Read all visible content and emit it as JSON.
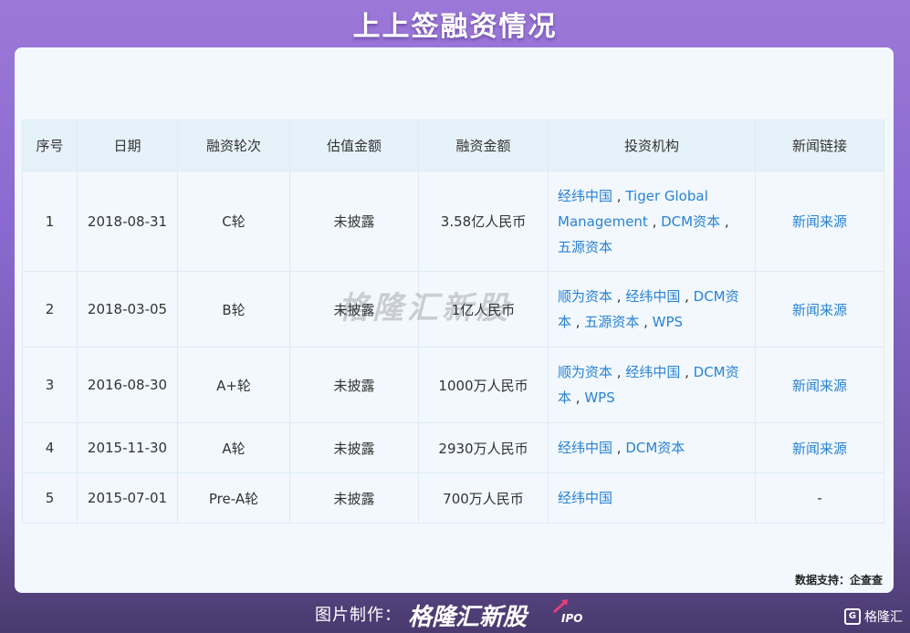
{
  "title": "上上签融资情况",
  "watermark": "格隆汇新股",
  "table": {
    "headers": [
      "序号",
      "日期",
      "融资轮次",
      "估值金额",
      "融资金额",
      "投资机构",
      "新闻链接"
    ],
    "rows": [
      {
        "no": "1",
        "date": "2018-08-31",
        "round": "C轮",
        "valuation": "未披露",
        "amount": "3.58亿人民币",
        "investors": [
          "经纬中国",
          "Tiger Global Management",
          "DCM资本",
          "五源资本"
        ],
        "news": "新闻来源"
      },
      {
        "no": "2",
        "date": "2018-03-05",
        "round": "B轮",
        "valuation": "未披露",
        "amount": "1亿人民币",
        "investors": [
          "顺为资本",
          "经纬中国",
          "DCM资本",
          "五源资本",
          "WPS"
        ],
        "news": "新闻来源"
      },
      {
        "no": "3",
        "date": "2016-08-30",
        "round": "A+轮",
        "valuation": "未披露",
        "amount": "1000万人民币",
        "investors": [
          "顺为资本",
          "经纬中国",
          "DCM资本",
          "WPS"
        ],
        "news": "新闻来源"
      },
      {
        "no": "4",
        "date": "2015-11-30",
        "round": "A轮",
        "valuation": "未披露",
        "amount": "2930万人民币",
        "investors": [
          "经纬中国",
          "DCM资本"
        ],
        "news": "新闻来源"
      },
      {
        "no": "5",
        "date": "2015-07-01",
        "round": "Pre-A轮",
        "valuation": "未披露",
        "amount": "700万人民币",
        "investors": [
          "经纬中国"
        ],
        "news": "-"
      }
    ]
  },
  "source": "数据支持：企查查",
  "footer": {
    "label": "图片制作：",
    "brand": "格隆汇新股",
    "brand_suffix": "IPO",
    "corner_logo": "格隆汇",
    "corner_logo_mark": "G"
  },
  "colors": {
    "link": "#2a82d4",
    "header_bg": "#e6f2fa",
    "card_bg": "#f2f8fd"
  }
}
